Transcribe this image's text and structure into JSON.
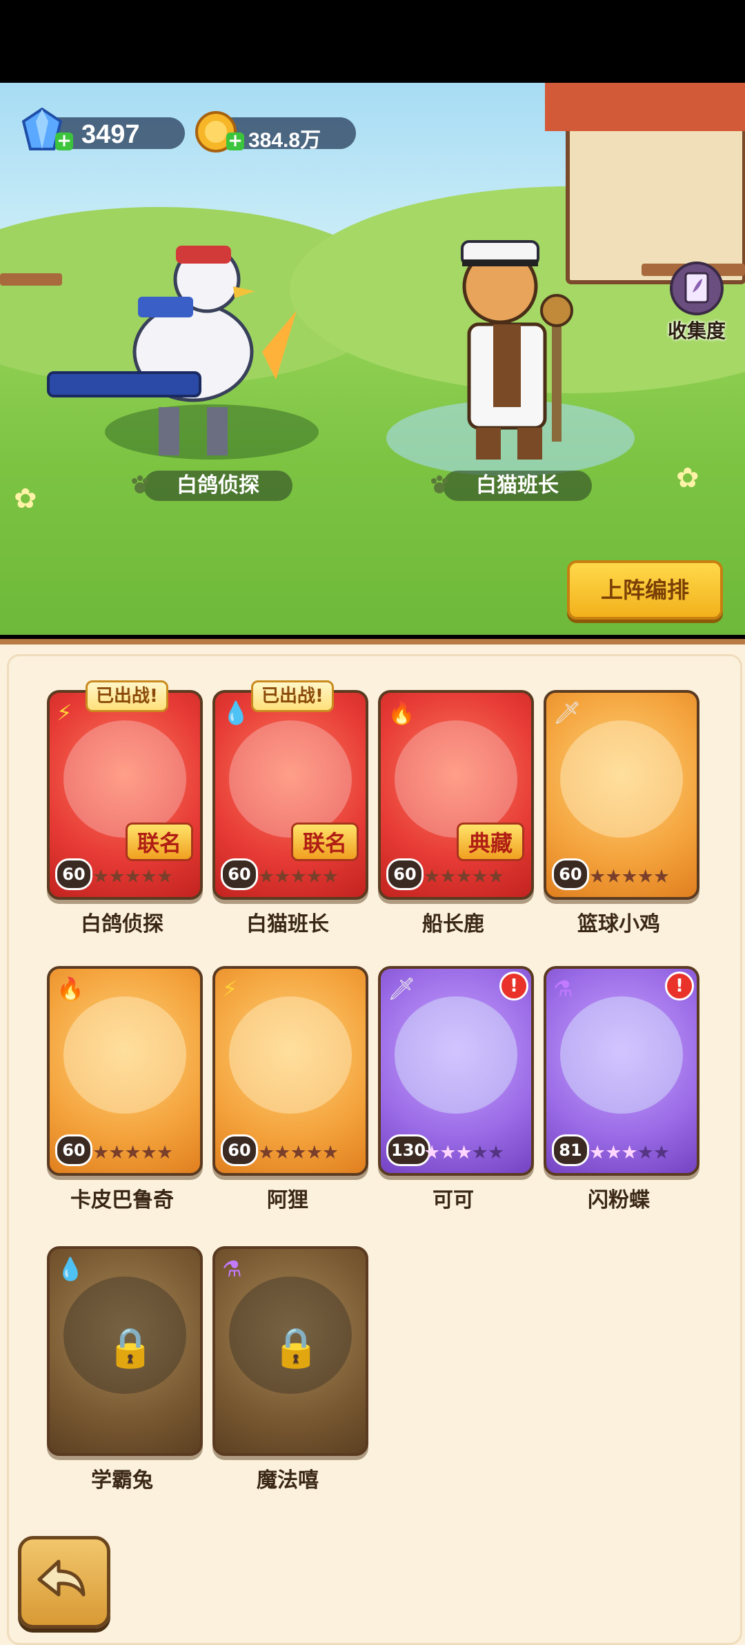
{
  "currency": {
    "gems": "3497",
    "coins": "384.8万"
  },
  "collection": {
    "label": "收集度"
  },
  "heroes_on_field": [
    {
      "name": "白鸽侦探"
    },
    {
      "name": "白猫班长"
    }
  ],
  "formation_button": "上阵编排",
  "deployed_badge": "已出战!",
  "cards": [
    {
      "name": "白鸽侦探",
      "level": "60",
      "tag": "联名",
      "deployed": true,
      "element": "lightning",
      "color": "red",
      "stars": 5
    },
    {
      "name": "白猫班长",
      "level": "60",
      "tag": "联名",
      "deployed": true,
      "element": "water",
      "color": "red",
      "stars": 5
    },
    {
      "name": "船长鹿",
      "level": "60",
      "tag": "典藏",
      "deployed": false,
      "element": "fire",
      "color": "red",
      "stars": 5
    },
    {
      "name": "篮球小鸡",
      "level": "60",
      "tag": "",
      "deployed": false,
      "element": "sword",
      "color": "orange",
      "stars": 5
    },
    {
      "name": "卡皮巴鲁奇",
      "level": "60",
      "tag": "",
      "deployed": false,
      "element": "fire",
      "color": "orange",
      "stars": 5
    },
    {
      "name": "阿狸",
      "level": "60",
      "tag": "",
      "deployed": false,
      "element": "lightning",
      "color": "orange",
      "stars": 5
    },
    {
      "name": "可可",
      "level": "130",
      "tag": "",
      "deployed": false,
      "element": "sword",
      "color": "purple",
      "stars": 3,
      "alert": true
    },
    {
      "name": "闪粉蝶",
      "level": "81",
      "tag": "",
      "deployed": false,
      "element": "potion",
      "color": "purple",
      "stars": 3,
      "alert": true
    },
    {
      "name": "学霸兔",
      "level": "",
      "tag": "",
      "deployed": false,
      "element": "water",
      "color": "locked",
      "locked": true
    },
    {
      "name": "魔法嘻",
      "level": "",
      "tag": "",
      "deployed": false,
      "element": "potion",
      "color": "locked",
      "locked": true
    }
  ],
  "alert_mark": "!"
}
